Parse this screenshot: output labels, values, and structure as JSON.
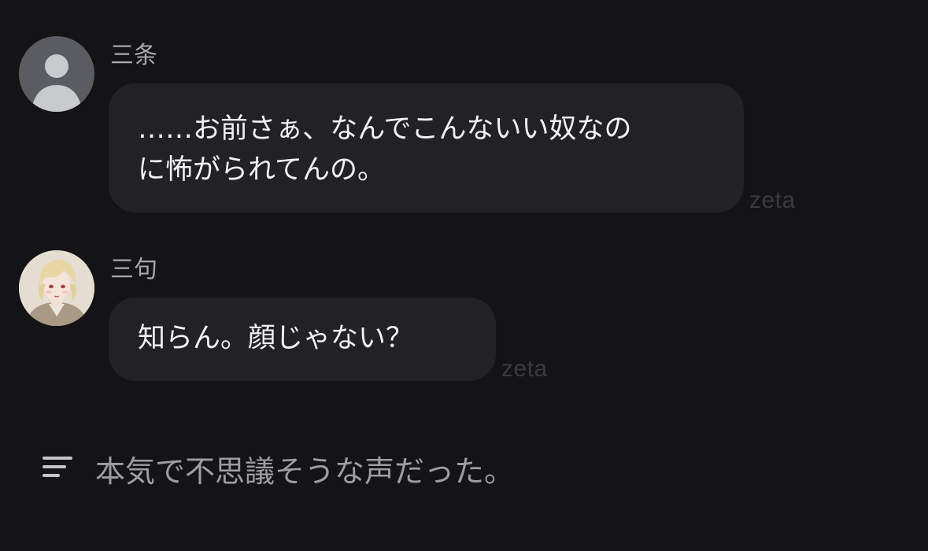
{
  "messages": [
    {
      "sender": "三条",
      "avatar_icon": "default-user-icon",
      "text": "……お前さぁ、なんでこんないい奴なの\nに怖がられてんの。",
      "watermark": "zeta"
    },
    {
      "sender": "三句",
      "avatar_icon": "character-portrait",
      "text": "知らん。顔じゃない？",
      "watermark": "zeta"
    }
  ],
  "narration": {
    "icon": "narration-lines-icon",
    "text": "本気で不思議そうな声だった。"
  },
  "colors": {
    "background": "#141416",
    "bubble": "#222225",
    "name": "#a7a8ad",
    "narration": "#9d9ea3",
    "watermark": "#3a3b3f"
  }
}
